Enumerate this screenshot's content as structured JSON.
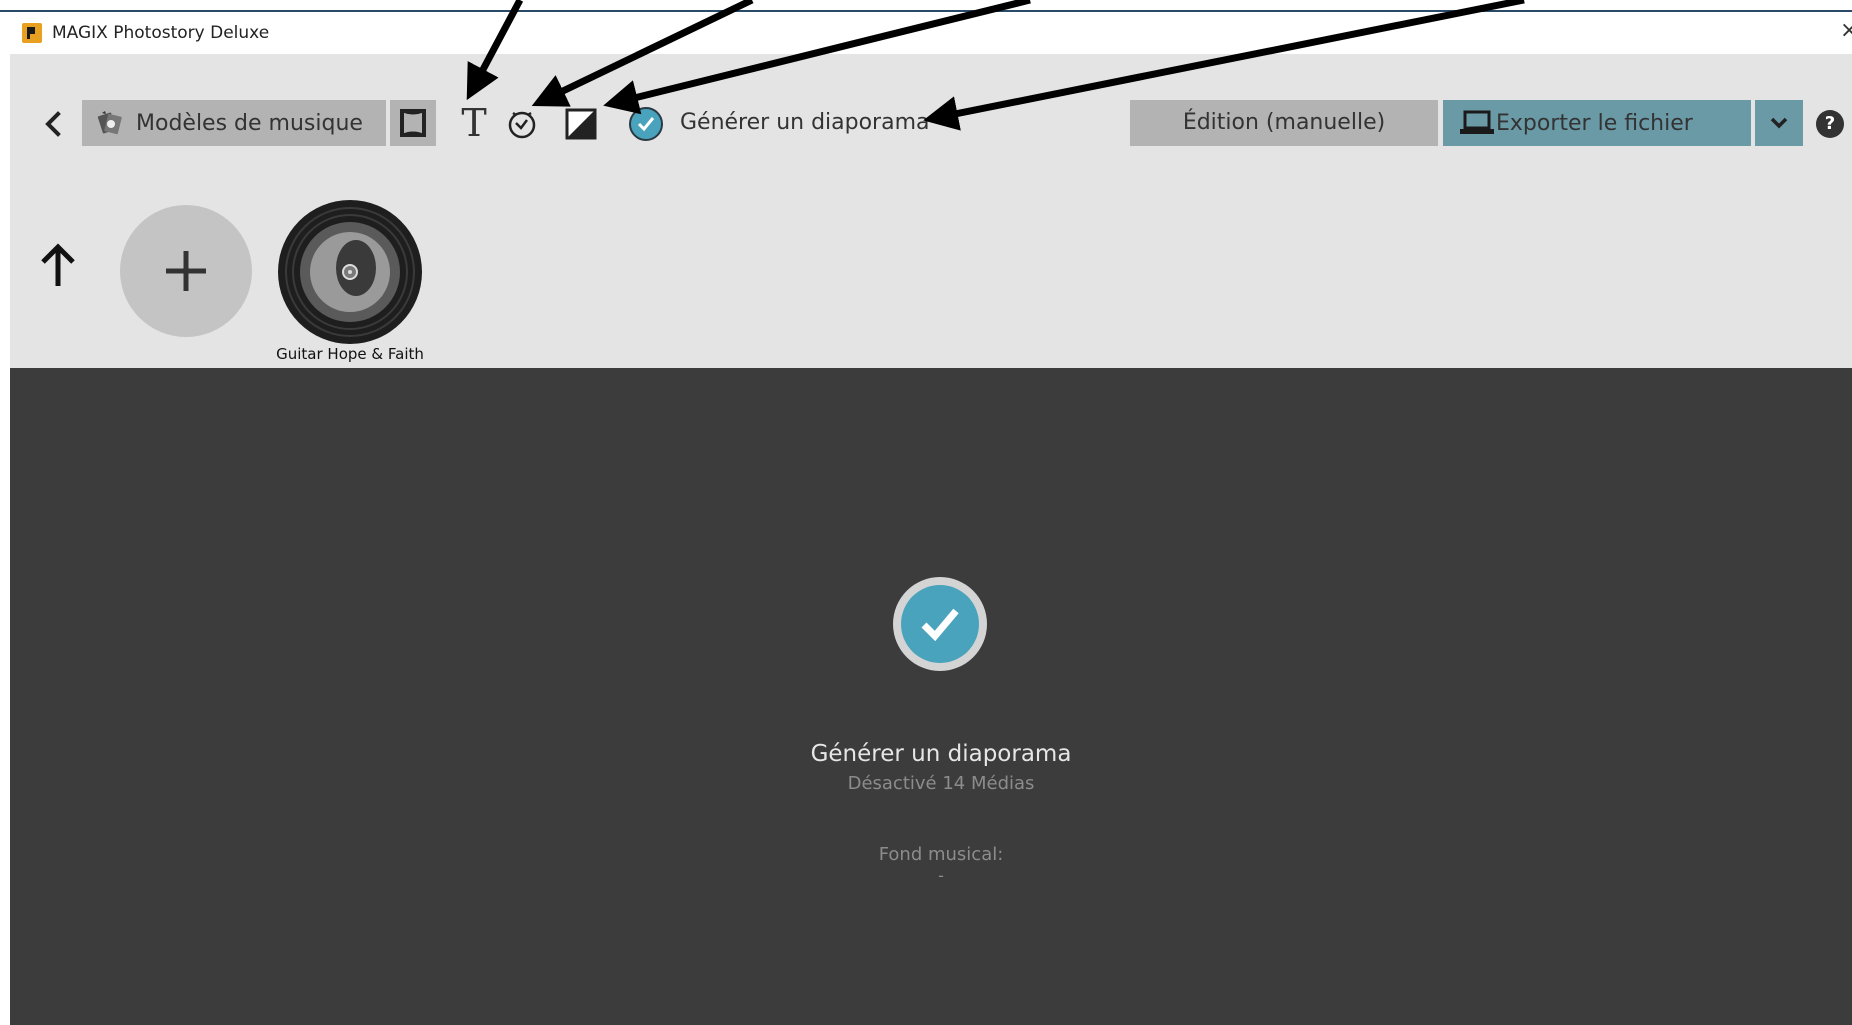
{
  "window": {
    "title": "MAGIX Photostory Deluxe",
    "close_symbol": "×"
  },
  "toolbar": {
    "music_templates_label": "Modèles de musique",
    "text_tool_symbol": "T",
    "generate_label": "Générer un diaporama",
    "edit_label": "Édition (manuelle)",
    "export_label": "Exporter le fichier",
    "help_symbol": "?",
    "icons": {
      "back": "chevron-left-icon",
      "templates": "music-templates-icon",
      "frame": "frame-icon",
      "text": "text-icon",
      "clock": "clock-icon",
      "contrast": "contrast-icon",
      "check": "check-circle-icon",
      "export": "laptop-icon",
      "dropdown": "chevron-down-icon"
    },
    "colors": {
      "accent": "#4aa3bc",
      "export_bg": "#6a9aa6",
      "button_bg": "#b3b3b3"
    }
  },
  "music_library": {
    "items": [
      {
        "label": "Guitar Hope & Faith"
      }
    ]
  },
  "main_panel": {
    "title": "Générer un diaporama",
    "subtitle": "Désactivé 14 Médias",
    "fond_label": "Fond musical:",
    "fond_value": "-",
    "background": "#3c3c3c"
  }
}
